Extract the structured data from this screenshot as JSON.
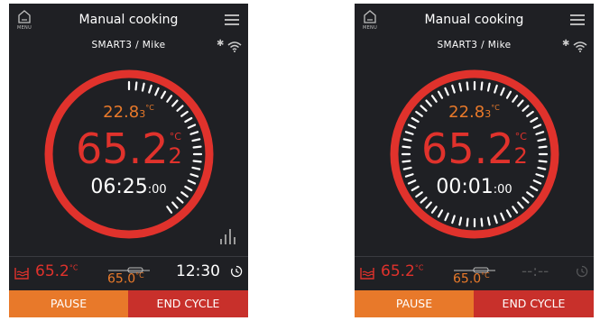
{
  "screens": [
    {
      "title": "Manual cooking",
      "home_caption": "MENU",
      "user": "SMART3 / Mike",
      "probe": {
        "main": "22.8",
        "sub": "3",
        "unit": "°C"
      },
      "bath": {
        "main": "65.2",
        "sub": "2",
        "unit": "°C"
      },
      "timer": {
        "main": "06:25",
        "small": ":00"
      },
      "progress": 0.42,
      "bottom": {
        "bath_temp": "65.2",
        "bath_unit": "°C",
        "set_temp": "65.0",
        "set_unit": "°C",
        "end_time": "12:30"
      },
      "buttons": {
        "pause": "PAUSE",
        "end": "END CYCLE"
      }
    },
    {
      "title": "Manual cooking",
      "home_caption": "MENU",
      "user": "SMART3 / Mike",
      "probe": {
        "main": "22.8",
        "sub": "3",
        "unit": "°C"
      },
      "bath": {
        "main": "65.2",
        "sub": "2",
        "unit": "°C"
      },
      "timer": {
        "main": "00:01",
        "small": ":00"
      },
      "progress": 1.0,
      "bottom": {
        "bath_temp": "65.2",
        "bath_unit": "°C",
        "set_temp": "65.0",
        "set_unit": "°C",
        "end_time": "--:--"
      },
      "buttons": {
        "pause": "PAUSE",
        "end": "END CYCLE"
      }
    }
  ],
  "colors": {
    "background": "#1f2024",
    "accent_red": "#e0322c",
    "accent_orange": "#e8792a",
    "pause_button": "#e8792a",
    "end_button": "#c8302b"
  },
  "icons": [
    "home-icon",
    "menu-icon",
    "bluetooth-icon",
    "wifi-icon",
    "graph-icon",
    "water-bath-icon",
    "set-temp-icon",
    "timer-icon"
  ]
}
